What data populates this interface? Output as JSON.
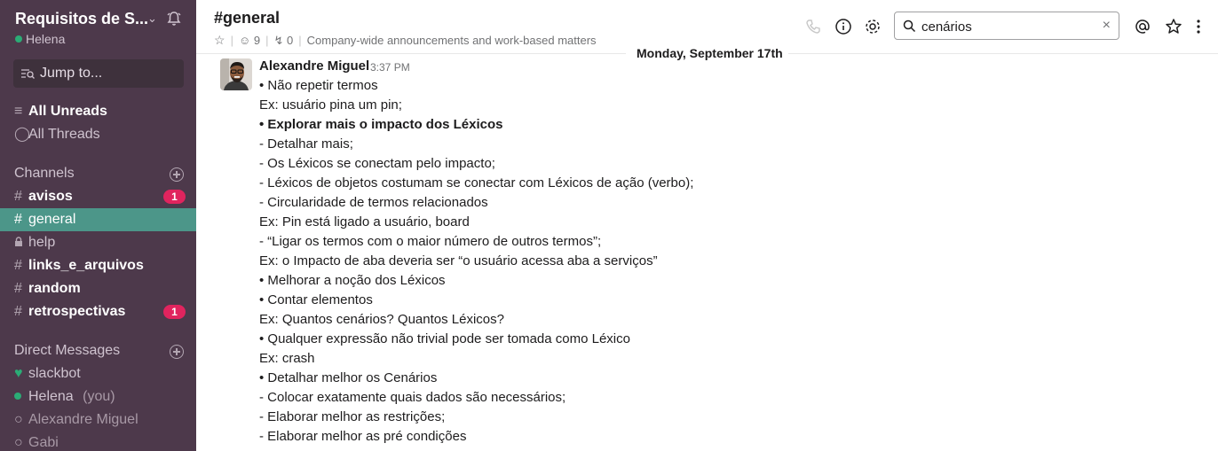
{
  "workspace": {
    "name": "Requisitos de S...",
    "user": "Helena"
  },
  "jump": {
    "label": "Jump to..."
  },
  "nav": {
    "all_unreads": "All Unreads",
    "all_threads": "All Threads"
  },
  "channels": {
    "heading": "Channels",
    "items": [
      {
        "prefix": "#",
        "label": "avisos",
        "badge": "1"
      },
      {
        "prefix": "#",
        "label": "general"
      },
      {
        "prefix": "lock",
        "label": "help"
      },
      {
        "prefix": "#",
        "label": "links_e_arquivos"
      },
      {
        "prefix": "#",
        "label": "random"
      },
      {
        "prefix": "#",
        "label": "retrospectivas",
        "badge": "1"
      }
    ]
  },
  "dms": {
    "heading": "Direct Messages",
    "items": [
      {
        "label": "slackbot"
      },
      {
        "label": "Helena",
        "suffix": "(you)"
      },
      {
        "label": "Alexandre Miguel"
      },
      {
        "label": "Gabi"
      }
    ]
  },
  "header": {
    "title": "#general",
    "members": "9",
    "pins": "0",
    "purpose": "Company-wide announcements and work-based matters"
  },
  "search": {
    "value": "cenários",
    "clear": "×"
  },
  "date_divider": "Monday, September 17th",
  "message": {
    "author": "Alexandre Miguel",
    "time": "3:37 PM",
    "lines": [
      "• Não repetir termos",
      "Ex: usuário pina um pin;",
      "• Explorar mais o impacto dos Léxicos",
      "- Detalhar mais;",
      "- Os Léxicos se conectam pelo impacto;",
      "- Léxicos de objetos costumam se conectar com Léxicos de ação (verbo);",
      "- Circularidade de termos relacionados",
      "Ex: Pin está ligado a usuário, board",
      "- “Ligar os termos com o maior número de outros termos”;",
      "Ex: o Impacto de aba deveria ser “o usuário acessa aba a serviços”",
      "• Melhorar a noção dos Léxicos",
      "• Contar elementos",
      "Ex: Quantos cenários? Quantos Léxicos?",
      "• Qualquer expressão não trivial pode ser tomada como Léxico",
      "Ex: crash",
      "• Detalhar melhor os Cenários",
      "- Colocar exatamente quais dados são necessários;",
      "- Elaborar melhor as restrições;",
      "- Elaborar melhor as pré condições"
    ]
  },
  "colors": {
    "sidebar": "#4d394b",
    "active": "#4c9689",
    "badge": "#e0245e",
    "presence": "#2bac76"
  }
}
